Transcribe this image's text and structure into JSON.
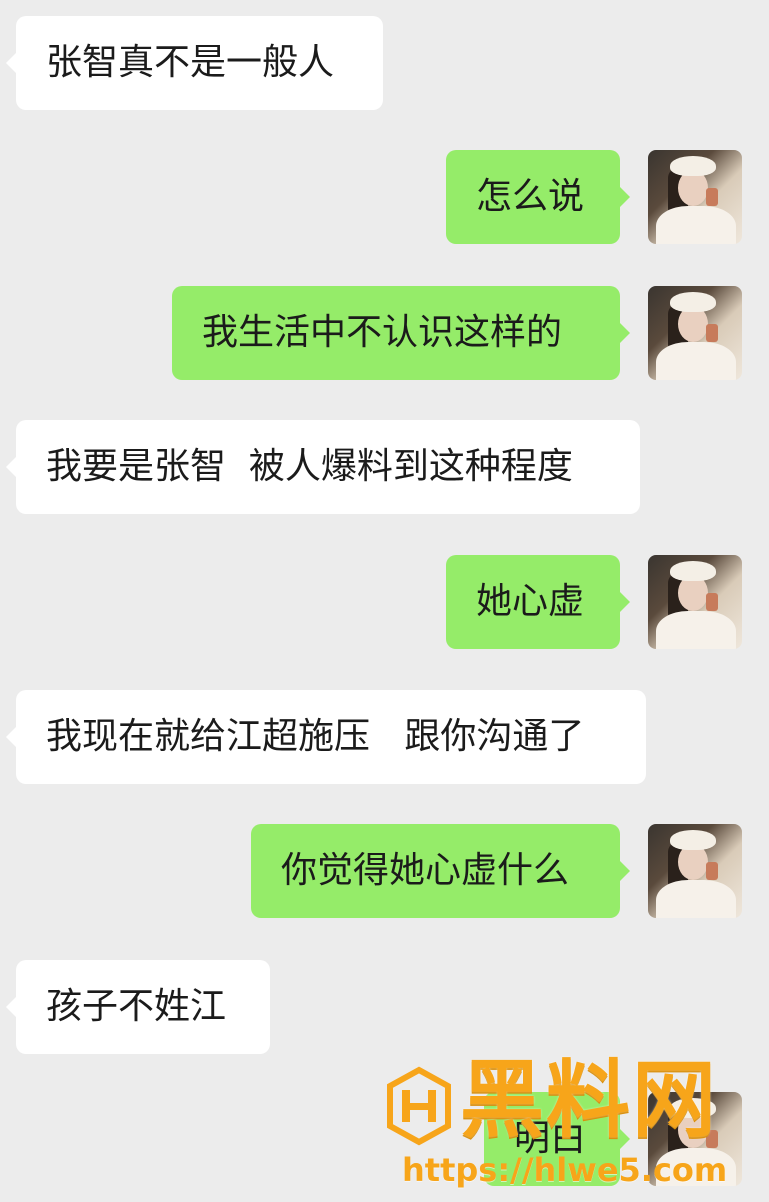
{
  "messages": [
    {
      "side": "in",
      "text": "张智真不是一般人"
    },
    {
      "side": "out",
      "text": "怎么说"
    },
    {
      "side": "out",
      "text": "我生活中不认识这样的"
    },
    {
      "side": "in",
      "text": "我要是张智  被人爆料到这种程度"
    },
    {
      "side": "out",
      "text": "她心虚"
    },
    {
      "side": "in",
      "text": "我现在就给江超施压   跟你沟通了"
    },
    {
      "side": "out",
      "text": "你觉得她心虚什么"
    },
    {
      "side": "in",
      "text": "孩子不姓江"
    },
    {
      "side": "out",
      "text": "明白"
    }
  ],
  "watermark": {
    "title": "黑料网",
    "url": "https://hlwe5.com"
  },
  "colors": {
    "background": "#ececec",
    "incoming_bubble": "#ffffff",
    "outgoing_bubble": "#95ec69",
    "watermark": "#f7a51a"
  }
}
